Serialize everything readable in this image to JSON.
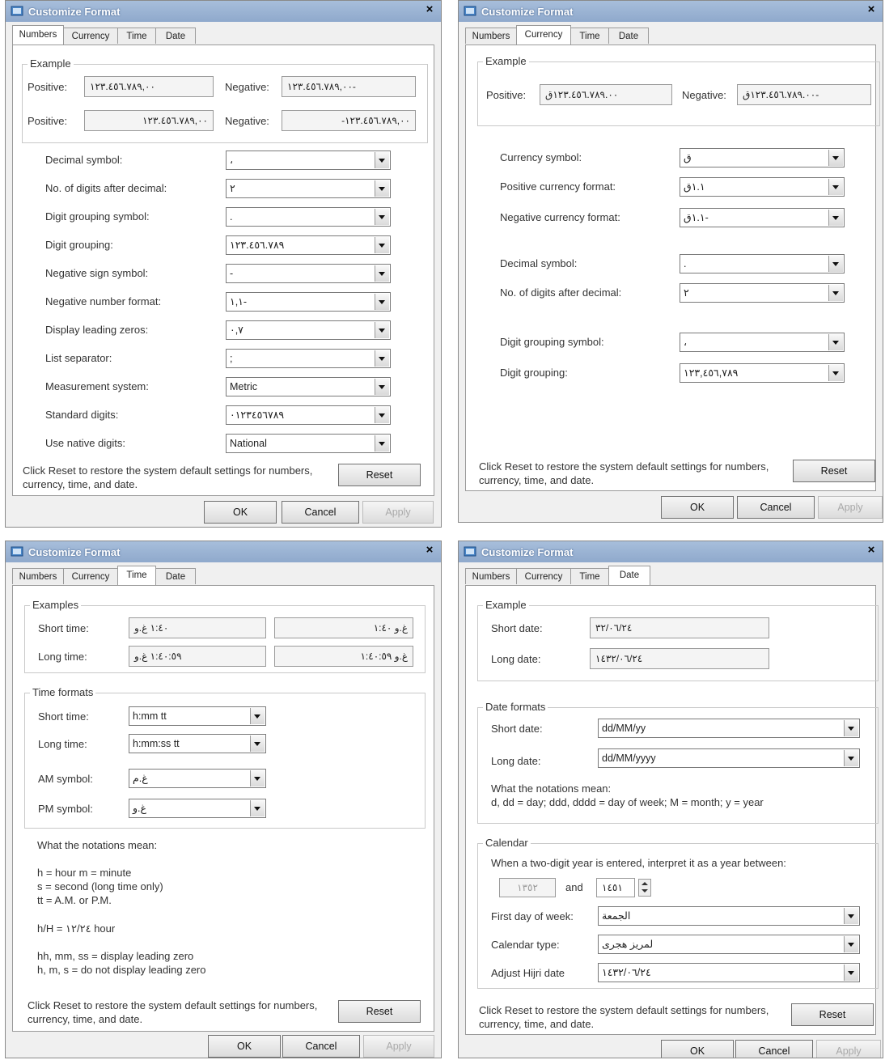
{
  "dialog_title": "Customize Format",
  "close_glyph": "×",
  "tabs": [
    "Numbers",
    "Currency",
    "Time",
    "Date"
  ],
  "buttons": {
    "ok": "OK",
    "cancel": "Cancel",
    "apply": "Apply",
    "reset": "Reset"
  },
  "reset_note": "Click Reset to restore the system default settings for numbers, currency, time, and date.",
  "icons": {
    "title": "settings-window-icon",
    "dropdown": "chevron-down-icon"
  },
  "numbers": {
    "example_legend": "Example",
    "rows": [
      {
        "pos_label": "Positive:",
        "pos_value": "١٢٣.٤٥٦.٧٨٩,٠٠",
        "neg_label": "Negative:",
        "neg_value": "١٢٣.٤٥٦.٧٨٩,٠٠-"
      },
      {
        "pos_label": "Positive:",
        "pos_value": "١٢٣.٤٥٦.٧٨٩,٠٠",
        "neg_label": "Negative:",
        "neg_value": "-١٢٣.٤٥٦.٧٨٩,٠٠"
      }
    ],
    "settings": [
      {
        "label": "Decimal symbol:",
        "value": "،"
      },
      {
        "label": "No. of digits after decimal:",
        "value": "٢"
      },
      {
        "label": "Digit grouping symbol:",
        "value": "."
      },
      {
        "label": "Digit grouping:",
        "value": "١٢٣.٤٥٦.٧٨٩"
      },
      {
        "label": "Negative sign symbol:",
        "value": "-"
      },
      {
        "label": "Negative number format:",
        "value": "١,١-"
      },
      {
        "label": "Display leading zeros:",
        "value": "٠,٧"
      },
      {
        "label": "List separator:",
        "value": ";"
      },
      {
        "label": "Measurement system:",
        "value": "Metric"
      },
      {
        "label": "Standard digits:",
        "value": "٠١٢٣٤٥٦٧٨٩"
      },
      {
        "label": "Use native digits:",
        "value": "National"
      }
    ]
  },
  "currency": {
    "example_legend": "Example",
    "pos_label": "Positive:",
    "pos_value": "١٢٣.٤٥٦.٧٨٩.٠٠ق",
    "neg_label": "Negative:",
    "neg_value": "١٢٣.٤٥٦.٧٨٩.٠٠ق-",
    "settings": [
      {
        "label": "Currency symbol:",
        "value": "ق"
      },
      {
        "label": "Positive currency format:",
        "value": "١.١ق"
      },
      {
        "label": "Negative currency format:",
        "value": "١.١ق-"
      },
      {
        "label": "Decimal symbol:",
        "value": "."
      },
      {
        "label": "No. of digits after decimal:",
        "value": "٢"
      },
      {
        "label": "Digit grouping symbol:",
        "value": "،"
      },
      {
        "label": "Digit grouping:",
        "value": "١٢٣,٤٥٦,٧٨٩"
      }
    ]
  },
  "time": {
    "examples_legend": "Examples",
    "short_label": "Short time:",
    "short_a": "١:٤٠ غ.و",
    "short_b": "غ.و ١:٤٠",
    "long_label": "Long time:",
    "long_a": "١:٤٠:٥٩ غ.و",
    "long_b": "غ.و ١:٤٠:٥٩",
    "formats_legend": "Time formats",
    "formats": [
      {
        "label": "Short time:",
        "value": "h:mm tt"
      },
      {
        "label": "Long time:",
        "value": "h:mm:ss tt"
      },
      {
        "label": "AM symbol:",
        "value": "غ.م"
      },
      {
        "label": "PM symbol:",
        "value": "غ.و"
      }
    ],
    "notation_title": "What the notations mean:",
    "notation_1": "h = hour   m = minute",
    "notation_2": "s = second (long time only)",
    "notation_3": "tt = A.M. or P.M.",
    "notation_4": "h/H = ١٢/٢٤ hour",
    "notation_5": "hh, mm, ss = display leading zero",
    "notation_6": "h, m, s = do not display leading zero"
  },
  "date": {
    "example_legend": "Example",
    "short_label": "Short date:",
    "short_value": "٣٢/٠٦/٢٤",
    "long_label": "Long date:",
    "long_value": "١٤٣٢/٠٦/٢٤",
    "formats_legend": "Date formats",
    "formats": [
      {
        "label": "Short date:",
        "value": "dd/MM/yy"
      },
      {
        "label": "Long date:",
        "value": "dd/MM/yyyy"
      }
    ],
    "notation_title": "What the notations mean:",
    "notation_text": "d, dd = day;  ddd, dddd = day of week;  M = month;  y = year",
    "calendar_legend": "Calendar",
    "two_digit_text": "When a two-digit year is entered, interpret it as a year between:",
    "year_from": "١٣٥٢",
    "and_label": "and",
    "year_to": "١٤٥١",
    "first_day_label": "First day of week:",
    "first_day_value": "الجمعة",
    "calendar_type_label": "Calendar type:",
    "calendar_type_value": "لمريز هجرى",
    "adjust_label": "Adjust Hijri date",
    "adjust_value": "١٤٣٢/٠٦/٢٤"
  }
}
